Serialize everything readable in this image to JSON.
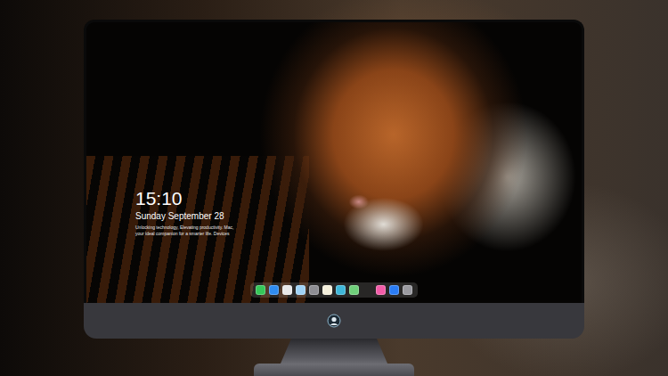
{
  "lock_screen": {
    "time": "15:10",
    "date": "Sunday September 28",
    "caption": "Unlocking technology, Elevating productivity. Mac, your ideal companion for a smarter life. Devices"
  },
  "dock": {
    "apps": [
      {
        "color": "#35c759"
      },
      {
        "color": "#2f8cf0"
      },
      {
        "color": "#e8e8e8"
      },
      {
        "color": "#9fd2f5"
      },
      {
        "color": "#8e8e93"
      },
      {
        "color": "#f5f0dc"
      },
      {
        "color": "#3fb7d9"
      },
      {
        "color": "#6fcf7a"
      }
    ],
    "extras": [
      {
        "color": "#f25ca8"
      },
      {
        "color": "#2a7cf5"
      },
      {
        "color": "#9a9aa0"
      }
    ]
  }
}
